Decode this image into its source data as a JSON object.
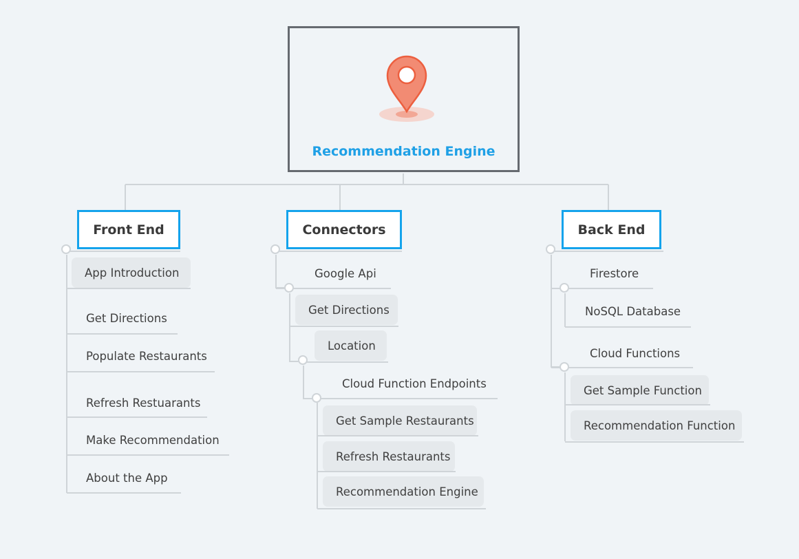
{
  "root": {
    "title": "Recommendation Engine",
    "icon": "map-pin-icon"
  },
  "colors": {
    "background": "#f0f4f7",
    "root_border": "#666a70",
    "root_title": "#1fa0e6",
    "branch_border": "#14a3ec",
    "connector": "#cfd4d8",
    "pin": "#f28b73"
  },
  "branches": [
    {
      "title": "Front End",
      "topics": [
        "App Introduction",
        "Get Directions",
        "Populate Restaurants",
        "Refresh Restuarants",
        "Make Recommendation",
        "About the App"
      ]
    },
    {
      "title": "Connectors",
      "topics": [
        {
          "label": "Google Api",
          "children": [
            "Get Directions",
            {
              "label": "Location",
              "children": [
                {
                  "label": "Cloud Function Endpoints",
                  "children": [
                    "Get Sample Restaurants",
                    "Refresh Restaurants",
                    "Recommendation Engine"
                  ]
                }
              ]
            }
          ]
        }
      ]
    },
    {
      "title": "Back End",
      "topics": [
        {
          "label": "Firestore",
          "children": [
            "NoSQL Database"
          ]
        },
        {
          "label": "Cloud Functions",
          "children": [
            "Get Sample Function",
            "Recommendation Function"
          ]
        }
      ]
    }
  ]
}
